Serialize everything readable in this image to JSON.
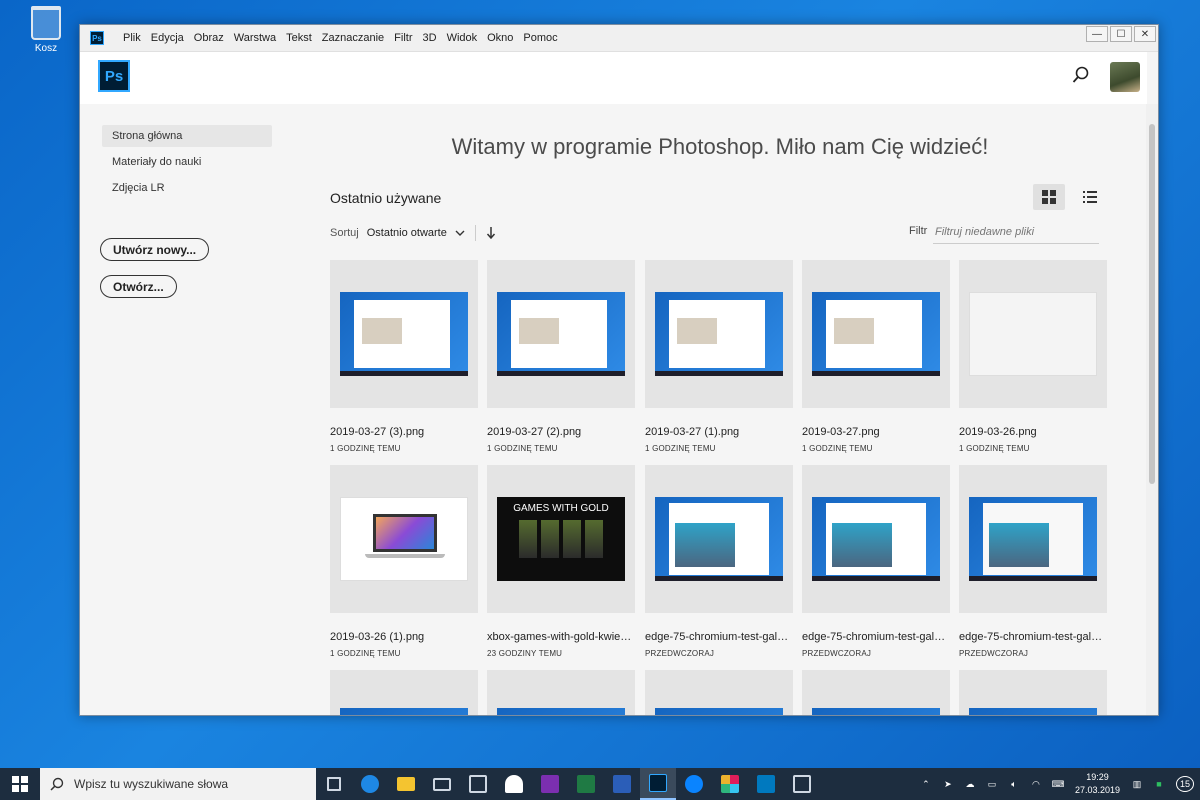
{
  "desktop": {
    "recycle_label": "Kosz"
  },
  "window": {
    "menu": [
      "Plik",
      "Edycja",
      "Obraz",
      "Warstwa",
      "Tekst",
      "Zaznaczanie",
      "Filtr",
      "3D",
      "Widok",
      "Okno",
      "Pomoc"
    ],
    "controls": {
      "min": "—",
      "max": "☐",
      "close": "✕"
    }
  },
  "app": {
    "logo": "Ps"
  },
  "sidebar": {
    "items": [
      {
        "label": "Strona główna"
      },
      {
        "label": "Materiały do nauki"
      },
      {
        "label": "Zdjęcia LR"
      }
    ],
    "create_label": "Utwórz nowy...",
    "open_label": "Otwórz..."
  },
  "main": {
    "welcome": "Witamy w programie Photoshop. Miło nam Cię widzieć!",
    "recent_title": "Ostatnio używane",
    "sort_label": "Sortuj",
    "sort_value": "Ostatnio otwarte",
    "filter_label": "Filtr",
    "filter_placeholder": "Filtruj niedawne pliki",
    "files": [
      {
        "name": "2019-03-27 (3).png",
        "meta": "1 GODZINĘ TEMU",
        "kind": "blue"
      },
      {
        "name": "2019-03-27 (2).png",
        "meta": "1 GODZINĘ TEMU",
        "kind": "blue"
      },
      {
        "name": "2019-03-27 (1).png",
        "meta": "1 GODZINĘ TEMU",
        "kind": "blue"
      },
      {
        "name": "2019-03-27.png",
        "meta": "1 GODZINĘ TEMU",
        "kind": "blue"
      },
      {
        "name": "2019-03-26.png",
        "meta": "1 GODZINĘ TEMU",
        "kind": "white"
      },
      {
        "name": "2019-03-26 (1).png",
        "meta": "1 GODZINĘ TEMU",
        "kind": "laptop"
      },
      {
        "name": "xbox-games-with-gold-kwieci...",
        "meta": "23 GODZINY TEMU",
        "kind": "games",
        "thumb_text": "GAMES WITH GOLD"
      },
      {
        "name": "edge-75-chromium-test-galeri...",
        "meta": "PRZEDWCZORAJ",
        "kind": "edge"
      },
      {
        "name": "edge-75-chromium-test-galeri...",
        "meta": "PRZEDWCZORAJ",
        "kind": "edge"
      },
      {
        "name": "edge-75-chromium-test-galeri...",
        "meta": "PRZEDWCZORAJ",
        "kind": "white"
      }
    ]
  },
  "taskbar": {
    "search_placeholder": "Wpisz tu wyszukiwane słowa",
    "time": "19:29",
    "date": "27.03.2019",
    "notif_count": "15",
    "apps": [
      {
        "name": "task-view",
        "color": "#cfd8e3"
      },
      {
        "name": "edge",
        "color": "#1e88e5"
      },
      {
        "name": "file-explorer",
        "color": "#f4c430"
      },
      {
        "name": "mail",
        "color": "#cfd8e3"
      },
      {
        "name": "calendar",
        "color": "#cfd8e3"
      },
      {
        "name": "people",
        "color": "#ffffff"
      },
      {
        "name": "onenote",
        "color": "#7b2fb0"
      },
      {
        "name": "excel",
        "color": "#1f7a44"
      },
      {
        "name": "word",
        "color": "#2b5eb8"
      },
      {
        "name": "photoshop",
        "color": "#001d34"
      },
      {
        "name": "messenger",
        "color": "#0a84ff"
      },
      {
        "name": "slack",
        "color": "#e01e5a"
      },
      {
        "name": "trello",
        "color": "#0079bf"
      },
      {
        "name": "photos",
        "color": "#cfd8e3"
      }
    ]
  }
}
